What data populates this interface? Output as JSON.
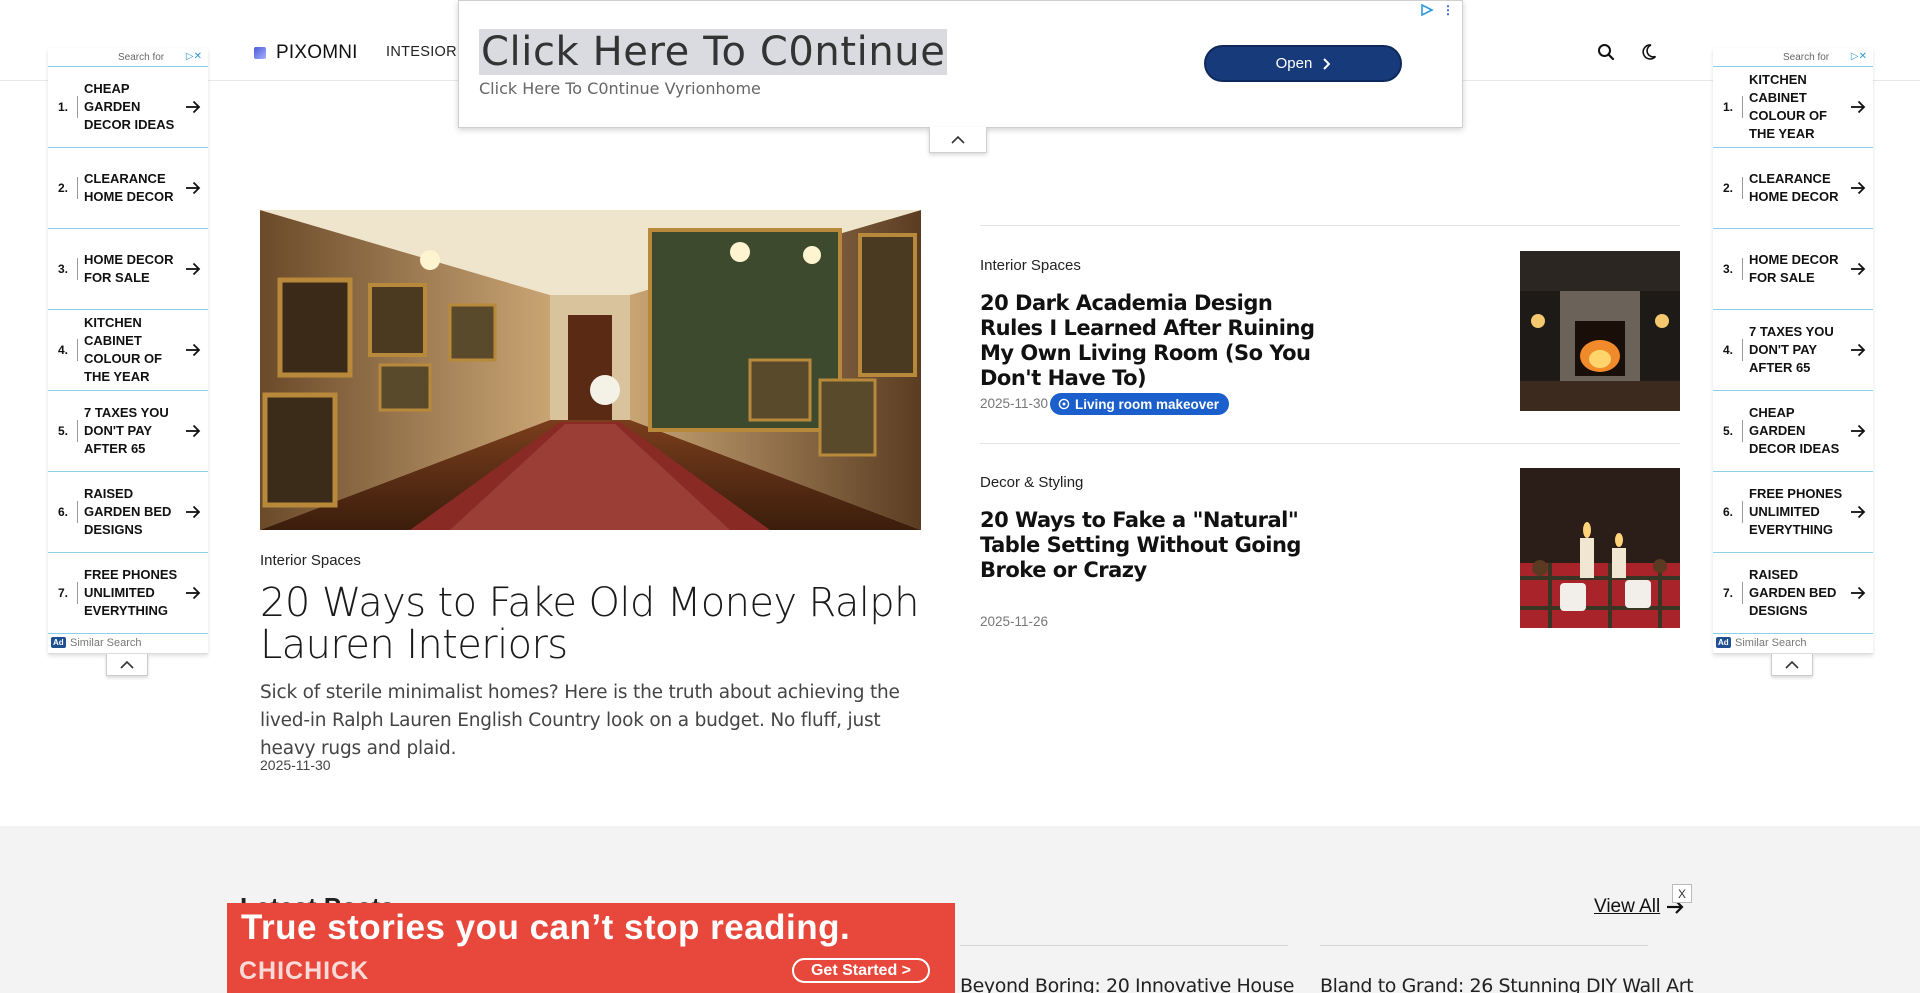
{
  "header": {
    "logo_text": "PIXOMNI",
    "nav_first": "INTESIOR S"
  },
  "top_ad": {
    "title": "Click Here To C0ntinue",
    "subtitle": "Click Here To C0ntinue Vyrionhome",
    "button": "Open"
  },
  "left_rail": {
    "search_for": "Search for",
    "footer": "Similar Search",
    "ad_badge": "Ad",
    "items": [
      {
        "num": "1.",
        "label": "CHEAP GARDEN DECOR IDEAS"
      },
      {
        "num": "2.",
        "label": "CLEARANCE HOME DECOR"
      },
      {
        "num": "3.",
        "label": "HOME DECOR FOR SALE"
      },
      {
        "num": "4.",
        "label": "KITCHEN CABINET COLOUR OF THE YEAR"
      },
      {
        "num": "5.",
        "label": "7 TAXES YOU DON'T PAY AFTER 65"
      },
      {
        "num": "6.",
        "label": "RAISED GARDEN BED DESIGNS"
      },
      {
        "num": "7.",
        "label": "FREE PHONES UNLIMITED EVERYTHING"
      }
    ]
  },
  "right_rail": {
    "search_for": "Search for",
    "footer": "Similar Search",
    "ad_badge": "Ad",
    "items": [
      {
        "num": "1.",
        "label": "KITCHEN CABINET COLOUR OF THE YEAR"
      },
      {
        "num": "2.",
        "label": "CLEARANCE HOME DECOR"
      },
      {
        "num": "3.",
        "label": "HOME DECOR FOR SALE"
      },
      {
        "num": "4.",
        "label": "7 TAXES YOU DON'T PAY AFTER 65"
      },
      {
        "num": "5.",
        "label": "CHEAP GARDEN DECOR IDEAS"
      },
      {
        "num": "6.",
        "label": "FREE PHONES UNLIMITED EVERYTHING"
      },
      {
        "num": "7.",
        "label": "RAISED GARDEN BED DESIGNS"
      }
    ]
  },
  "featured": {
    "category": "Interior Spaces",
    "title": "20 Ways to Fake Old Money Ralph Lauren Interiors",
    "excerpt": "Sick of sterile minimalist homes? Here is the truth about achieving the lived-in Ralph Lauren English Country look on a budget. No fluff, just heavy rugs and plaid.",
    "date": "2025-11-30"
  },
  "side_posts": [
    {
      "category": "Interior Spaces",
      "title": "20 Dark Academia Design Rules I Learned After Ruining My Own Living Room (So You Don't Have To)",
      "date": "2025-11-30",
      "tag": "Living room makeover"
    },
    {
      "category": "Decor & Styling",
      "title": "20 Ways to Fake a \"Natural\" Table Setting Without Going Broke or Crazy",
      "date": "2025-11-26"
    }
  ],
  "latest": {
    "title": "Latest Posts",
    "view_all": "View All",
    "items": [
      "Beyond Boring: 20 Innovative House",
      "Bland to Grand: 26 Stunning DIY Wall Art"
    ]
  },
  "bottom_ad": {
    "headline": "True stories you can’t stop reading.",
    "brand": "CHICHICK",
    "cta": "Get Started  >",
    "close": "X"
  }
}
